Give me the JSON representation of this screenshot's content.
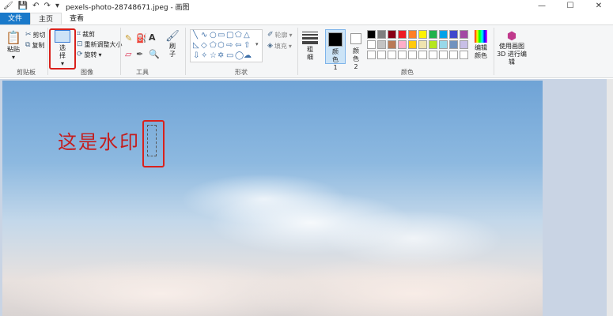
{
  "titlebar": {
    "title": "pexels-photo-28748671.jpeg - 画图",
    "qat_icons": [
      "paint-app-icon",
      "save-icon",
      "undo-icon",
      "redo-icon",
      "qat-menu-icon"
    ],
    "controls": [
      "—",
      "☐",
      "✕"
    ]
  },
  "tabs": [
    {
      "label": "文件"
    },
    {
      "label": "主页"
    },
    {
      "label": "查看"
    }
  ],
  "clipboard": {
    "paste_label": "粘贴",
    "cut_label": "剪切",
    "copy_label": "复制",
    "group_label": "剪贴板"
  },
  "image_group": {
    "select_label": "选择",
    "crop_label": "裁剪",
    "resize_label": "重新调整大小",
    "rotate_label": "旋转",
    "group_label": "图像"
  },
  "tools": {
    "group_label": "工具",
    "brush_label": "刷子",
    "text_glyph": "A"
  },
  "shapes": {
    "outline_label": "轮廓",
    "fill_label": "填充",
    "group_label": "形状"
  },
  "size": {
    "label": "粗细"
  },
  "colors": {
    "color1_label": "颜色 1",
    "color2_label": "颜色 2",
    "edit_label": "编辑颜色",
    "group_label": "颜色",
    "color1": "#000000",
    "color2": "#ffffff",
    "palette_row1": [
      "#000000",
      "#7f7f7f",
      "#880015",
      "#ed1c24",
      "#ff7f27",
      "#fff200",
      "#22b14c",
      "#00a2e8",
      "#3f48cc",
      "#a349a4"
    ],
    "palette_row2": [
      "#ffffff",
      "#c3c3c3",
      "#b97a57",
      "#ffaec9",
      "#ffc90e",
      "#efe4b0",
      "#b5e61d",
      "#99d9ea",
      "#7092be",
      "#c8bfe7"
    ]
  },
  "paint3d": {
    "label": "使用画图 3D 进行编辑"
  },
  "canvas": {
    "watermark_text": "这是水印"
  }
}
